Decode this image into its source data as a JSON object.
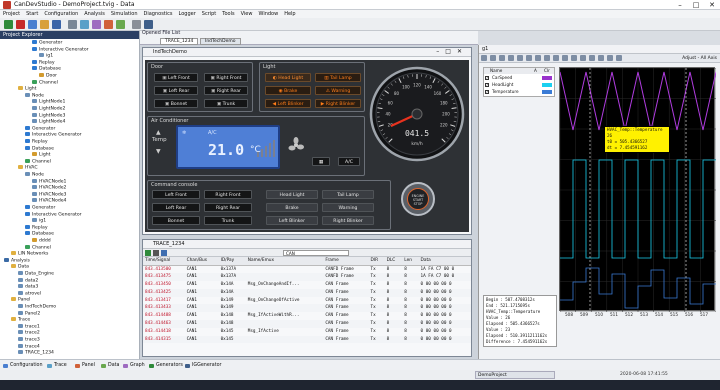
{
  "app": {
    "title": "CanDevStudio - DemoProject.tvig - Data"
  },
  "menu": [
    "Project",
    "Start",
    "Configuration",
    "Analysis",
    "Simulation",
    "Diagnostics",
    "Logger",
    "Script",
    "Tools",
    "View",
    "Window",
    "Help"
  ],
  "explorer": {
    "title": "Project Explorer",
    "items": [
      {
        "label": "Generator",
        "depth": 4,
        "c": "#2e7ad1"
      },
      {
        "label": "Interactive Generator",
        "depth": 4,
        "c": "#2e7ad1"
      },
      {
        "label": "ig1",
        "depth": 5,
        "c": "#6a8fb7"
      },
      {
        "label": "Replay",
        "depth": 4,
        "c": "#2e7ad1"
      },
      {
        "label": "Database",
        "depth": 4,
        "c": "#2e7ad1"
      },
      {
        "label": "Door",
        "depth": 5,
        "c": "#d39b2e"
      },
      {
        "label": "Channel",
        "depth": 4,
        "c": "#3aa05a"
      },
      {
        "label": "Light",
        "depth": 2,
        "c": "#e0b040"
      },
      {
        "label": "Node",
        "depth": 3,
        "c": "#6a8fb7"
      },
      {
        "label": "LightNode1",
        "depth": 4,
        "c": "#6a8fb7"
      },
      {
        "label": "LightNode2",
        "depth": 4,
        "c": "#6a8fb7"
      },
      {
        "label": "LightNode3",
        "depth": 4,
        "c": "#6a8fb7"
      },
      {
        "label": "LightNode4",
        "depth": 4,
        "c": "#6a8fb7"
      },
      {
        "label": "Generator",
        "depth": 3,
        "c": "#2e7ad1"
      },
      {
        "label": "Interactive Generator",
        "depth": 3,
        "c": "#2e7ad1"
      },
      {
        "label": "Replay",
        "depth": 3,
        "c": "#2e7ad1"
      },
      {
        "label": "Database",
        "depth": 3,
        "c": "#2e7ad1"
      },
      {
        "label": "Light",
        "depth": 4,
        "c": "#d39b2e"
      },
      {
        "label": "Channel",
        "depth": 3,
        "c": "#3aa05a"
      },
      {
        "label": "HVAC",
        "depth": 2,
        "c": "#e0b040"
      },
      {
        "label": "Node",
        "depth": 3,
        "c": "#6a8fb7"
      },
      {
        "label": "HVACNode1",
        "depth": 4,
        "c": "#6a8fb7"
      },
      {
        "label": "HVACNode2",
        "depth": 4,
        "c": "#6a8fb7"
      },
      {
        "label": "HVACNode3",
        "depth": 4,
        "c": "#6a8fb7"
      },
      {
        "label": "HVACNode4",
        "depth": 4,
        "c": "#6a8fb7"
      },
      {
        "label": "Generator",
        "depth": 3,
        "c": "#2e7ad1"
      },
      {
        "label": "Interactive Generator",
        "depth": 3,
        "c": "#2e7ad1"
      },
      {
        "label": "ig1",
        "depth": 4,
        "c": "#6a8fb7"
      },
      {
        "label": "Replay",
        "depth": 3,
        "c": "#2e7ad1"
      },
      {
        "label": "Database",
        "depth": 3,
        "c": "#2e7ad1"
      },
      {
        "label": "dddd",
        "depth": 4,
        "c": "#d39b2e"
      },
      {
        "label": "Channel",
        "depth": 3,
        "c": "#3aa05a"
      },
      {
        "label": "LIN Networks",
        "depth": 1,
        "c": "#e0b040"
      },
      {
        "label": "Analysis",
        "depth": 0,
        "c": "#3a6aa5"
      },
      {
        "label": "Data",
        "depth": 1,
        "c": "#e0b040"
      },
      {
        "label": "Data_Engine",
        "depth": 2,
        "c": "#6a8fb7"
      },
      {
        "label": "data2",
        "depth": 2,
        "c": "#6a8fb7"
      },
      {
        "label": "data3",
        "depth": 2,
        "c": "#6a8fb7"
      },
      {
        "label": "atrovel",
        "depth": 2,
        "c": "#6a8fb7"
      },
      {
        "label": "Panel",
        "depth": 1,
        "c": "#e0b040"
      },
      {
        "label": "IndTechDemo",
        "depth": 2,
        "c": "#6a8fb7"
      },
      {
        "label": "Panel2",
        "depth": 2,
        "c": "#6a8fb7"
      },
      {
        "label": "Trace",
        "depth": 1,
        "c": "#e0b040"
      },
      {
        "label": "trace1",
        "depth": 2,
        "c": "#6a8fb7"
      },
      {
        "label": "trace2",
        "depth": 2,
        "c": "#6a8fb7"
      },
      {
        "label": "trace3",
        "depth": 2,
        "c": "#6a8fb7"
      },
      {
        "label": "trace4",
        "depth": 2,
        "c": "#6a8fb7"
      },
      {
        "label": "TRACE_1234",
        "depth": 2,
        "c": "#6a8fb7"
      }
    ]
  },
  "filelist": {
    "title": "Opened File List",
    "tabs": [
      "TRACE_1234",
      "IndTechDemo"
    ]
  },
  "dash": {
    "title": "IndTechDemo",
    "door": {
      "label": "Door",
      "buttons": [
        "Left Front",
        "Right Front",
        "Left Rear",
        "Right Rear",
        "Bonnet",
        "Trunk"
      ]
    },
    "light": {
      "label": "Light",
      "buttons": [
        "Head Light",
        "Tail Lamp",
        "Brake",
        "Warning",
        "Left Blinker",
        "Right Blinker"
      ]
    },
    "ac": {
      "label": "Air Conditioner",
      "temp_label": "Temp",
      "mode": "A/C",
      "temp": "21.0",
      "unit": "°C",
      "button": "A/C"
    },
    "command": {
      "label": "Command console",
      "left": [
        "Left Front",
        "Right Front",
        "Left Rear",
        "Right Rear",
        "Bonnet",
        "Trunk"
      ],
      "right": [
        "Head Light",
        "Tail Lamp",
        "Brake",
        "Warning",
        "Left Blinker",
        "Right Blinker"
      ]
    },
    "gauge": {
      "value": "041.5",
      "unit": "km/h",
      "ticks": [
        "20",
        "40",
        "60",
        "80",
        "100",
        "120",
        "140",
        "160",
        "180",
        "200",
        "220"
      ]
    },
    "engine": {
      "line1": "ENGINE",
      "line2": "START",
      "line3": "STOP"
    }
  },
  "trace": {
    "title": "TRACE_1234",
    "channel": "CAN",
    "columns": [
      "Time/Signal",
      "Chan/Bus",
      "ID/Pay",
      "Name/Emux",
      "Frame",
      "DIR",
      "DLC",
      "Len",
      "Data"
    ],
    "rows": [
      [
        "843.413500",
        "CAN1",
        "0x137A",
        "",
        "CANFD Frame",
        "Tx",
        "8",
        "8",
        "1A FA C7 00 0"
      ],
      [
        "843.413475",
        "CAN1",
        "0x137A",
        "",
        "CANFD Frame",
        "Tx",
        "8",
        "8",
        "1A FA C7 00 0"
      ],
      [
        "843.413450",
        "CAN1",
        "0x14A",
        "Msg_OnChangeAndIf...",
        "CAN Frame",
        "Tx",
        "8",
        "8",
        "0 00 00 00 0"
      ],
      [
        "843.413425",
        "CAN1",
        "0x14A",
        "",
        "CAN Frame",
        "Tx",
        "8",
        "8",
        "0 00 00 00 0"
      ],
      [
        "843.413417",
        "CAN1",
        "0x149",
        "Msg_OnChangeOfActive",
        "CAN Frame",
        "Tx",
        "8",
        "8",
        "0 00 00 00 0"
      ],
      [
        "843.413433",
        "CAN1",
        "0x149",
        "",
        "CAN Frame",
        "Tx",
        "8",
        "8",
        "0 00 00 00 0"
      ],
      [
        "843.414488",
        "CAN1",
        "0x148",
        "Msg_IfActiveWithR...",
        "CAN Frame",
        "Tx",
        "8",
        "8",
        "0 00 00 00 0"
      ],
      [
        "843.414463",
        "CAN1",
        "0x148",
        "",
        "CAN Frame",
        "Tx",
        "8",
        "8",
        "0 00 00 00 0"
      ],
      [
        "843.414418",
        "CAN1",
        "0x145",
        "Msg_IfActive",
        "CAN Frame",
        "Tx",
        "8",
        "8",
        "0 00 00 00 0"
      ],
      [
        "843.414315",
        "CAN1",
        "0x145",
        "",
        "CAN Frame",
        "Tx",
        "8",
        "8",
        "0 00 00 00 0"
      ]
    ]
  },
  "graph": {
    "title": "g1",
    "adjust": "Adjust - All Axis",
    "legend_headers": [
      "Name",
      "A",
      "Clr"
    ],
    "signals": [
      {
        "name": "CarSpeed",
        "color": "#9932cc"
      },
      {
        "name": "HeadLight",
        "color": "#1ad0f0"
      },
      {
        "name": "Temperature",
        "color": "#3a7bd5"
      }
    ],
    "tooltip": [
      "HVAC_Temp::Temperature",
      "26",
      "t0 = 505.4366527",
      "dt = 7.454591162"
    ],
    "stats": [
      [
        "Begin",
        ": 507.4708312s"
      ],
      [
        "End",
        ": 521.1715695s"
      ],
      [
        "HVAC_Temp::Temperature",
        ""
      ],
      [
        "Value",
        ": 26"
      ],
      [
        "Elapsed",
        ": 505.4366527s"
      ],
      [
        "Value",
        ": 23"
      ],
      [
        "Elapsed",
        ": 510.3911211162s"
      ],
      [
        "Difference",
        ": 7.454591162s"
      ]
    ],
    "xticks": [
      "508",
      "509",
      "510",
      "511",
      "512",
      "513",
      "514",
      "515",
      "516",
      "517"
    ]
  },
  "bottomtabs": [
    "Configuration",
    "Trace",
    "Panel",
    "Data",
    "Graph",
    "Generators",
    "IGGenerator"
  ],
  "status": {
    "project": "DemoProject",
    "time": "2020-06-08 17:41:55"
  }
}
